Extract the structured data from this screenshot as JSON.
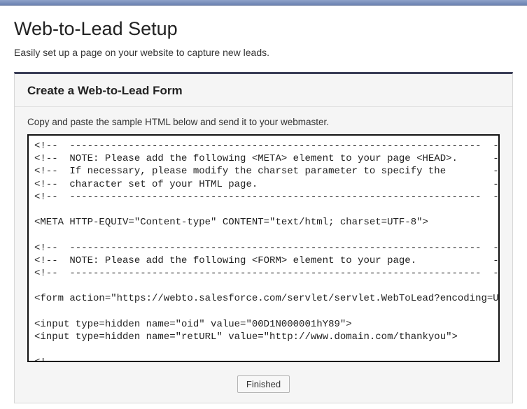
{
  "page": {
    "title": "Web-to-Lead Setup",
    "subtitle": "Easily set up a page on your website to capture new leads."
  },
  "panel": {
    "header": "Create a Web-to-Lead Form",
    "instruction": "Copy and paste the sample HTML below and send it to your webmaster.",
    "code": "<!--  ----------------------------------------------------------------------  -->\n<!--  NOTE: Please add the following <META> element to your page <HEAD>.      -->\n<!--  If necessary, please modify the charset parameter to specify the        -->\n<!--  character set of your HTML page.                                        -->\n<!--  ----------------------------------------------------------------------  -->\n\n<META HTTP-EQUIV=\"Content-type\" CONTENT=\"text/html; charset=UTF-8\">\n\n<!--  ----------------------------------------------------------------------  -->\n<!--  NOTE: Please add the following <FORM> element to your page.             -->\n<!--  ----------------------------------------------------------------------  -->\n\n<form action=\"https://webto.salesforce.com/servlet/servlet.WebToLead?encoding=UTF-8\" method=\"POST\">\n\n<input type=hidden name=\"oid\" value=\"00D1N000001hY89\">\n<input type=hidden name=\"retURL\" value=\"http://www.domain.com/thankyou\">\n\n<!--  ----------------------------------------------------------------------  -->\n<!--  NOTE: These fields are optional debugging elements. Please uncomment    -->\n<!--  these lines if you wish to test in debug mode.                          -->\n"
  },
  "buttons": {
    "finished": "Finished"
  }
}
